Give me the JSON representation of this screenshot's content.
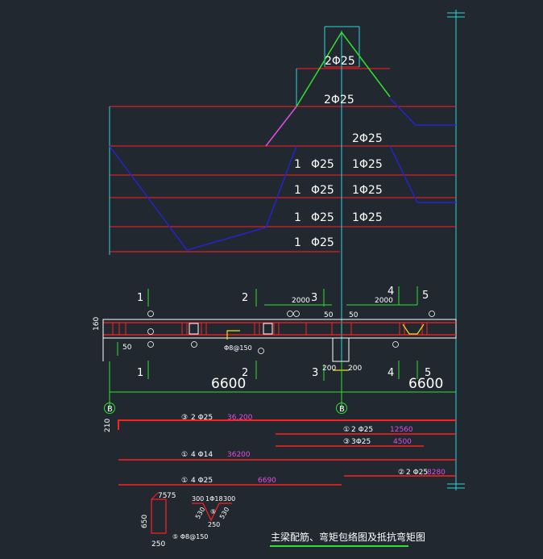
{
  "title": "主梁配筋、弯矩包络图及抵抗弯矩图",
  "envelope_labels": {
    "top": "2Φ25",
    "second": "2Φ25",
    "third": "2Φ25",
    "rows": [
      {
        "left": "1",
        "mid": "Φ25",
        "right": "1Φ25"
      },
      {
        "left": "1",
        "mid": "Φ25",
        "right": "1Φ25"
      },
      {
        "left": "1",
        "mid": "Φ25",
        "right": "1Φ25"
      },
      {
        "left": "1",
        "mid": "Φ25",
        "right": ""
      }
    ]
  },
  "sections": {
    "top": [
      "1",
      "2",
      "3",
      "4",
      "5"
    ],
    "bottom": [
      "1",
      "2",
      "3",
      "4",
      "5"
    ]
  },
  "dims": {
    "d2000a": "2000",
    "d2000b": "2000",
    "d50a": "50",
    "d50b": "50",
    "d50c": "50",
    "d160": "160",
    "d200a": "200",
    "d200b": "200",
    "span_left": "6600",
    "span_right": "6600"
  },
  "axes": {
    "a": "B",
    "b": "B"
  },
  "stirrup_note": "Φ8@150",
  "bars": [
    {
      "mark": "③",
      "spec": "2 Φ25",
      "length": "36,200"
    },
    {
      "mark": "①",
      "spec": "2 Φ25",
      "length": "12560"
    },
    {
      "mark": "③",
      "spec": "3Φ25",
      "length": "4500"
    },
    {
      "mark": "①",
      "spec": "4 Φ14",
      "length": "36200"
    },
    {
      "mark": "②",
      "spec": "2 Φ25",
      "length": "8280"
    },
    {
      "mark": "①",
      "spec": "4 Φ25",
      "length": "6690"
    }
  ],
  "details": {
    "d210": "210",
    "d75a": "75",
    "d75b": "75",
    "d650": "650",
    "d250a": "250",
    "stirrup": "⑤ Φ8@150",
    "d300a": "300",
    "d300b": "300",
    "bar_note": "1Φ18",
    "d250b": "250",
    "d530a": "530",
    "d530b": "530",
    "m9": "⑨"
  }
}
